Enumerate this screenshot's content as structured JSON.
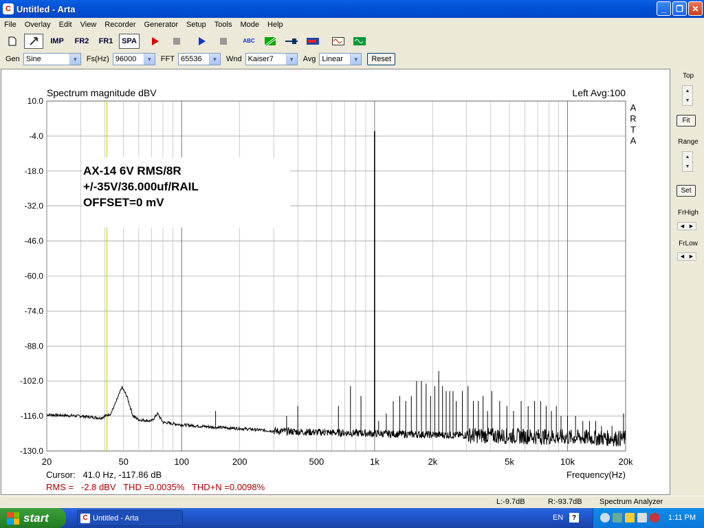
{
  "window": {
    "title": "Untitled - Arta",
    "icon_letter": "C"
  },
  "window_controls": {
    "minimize": "_",
    "maximize": "❐",
    "close": "✕"
  },
  "menu": [
    "File",
    "Overlay",
    "Edit",
    "View",
    "Recorder",
    "Generator",
    "Setup",
    "Tools",
    "Mode",
    "Help"
  ],
  "toolbar": {
    "imp": "IMP",
    "fr2": "FR2",
    "fr1": "FR1",
    "spa": "SPA",
    "abc": "ABC"
  },
  "controls": {
    "gen_label": "Gen",
    "gen_value": "Sine",
    "fs_label": "Fs(Hz)",
    "fs_value": "96000",
    "fft_label": "FFT",
    "fft_value": "65536",
    "wnd_label": "Wnd",
    "wnd_value": "Kaiser7",
    "avg_label": "Avg",
    "avg_value": "Linear",
    "reset_label": "Reset"
  },
  "right_panel": {
    "top": "Top",
    "fit": "Fit",
    "range": "Range",
    "set": "Set",
    "frhigh": "FrHigh",
    "frlow": "FrLow"
  },
  "plot": {
    "title": "Spectrum magnitude dBV",
    "channel_info": "Left  Avg:100",
    "brand": [
      "A",
      "R",
      "T",
      "A"
    ],
    "annotation": [
      "AX-14 6V RMS/8R",
      "+/-35V/36.000uf/RAIL",
      "OFFSET=0 mV"
    ],
    "cursor": "Cursor:   41.0 Hz, -117.86 dB",
    "measurements": "RMS =   -2.8 dBV   THD =0.0035%   THD+N =0.0098%",
    "xlabel": "Frequency(Hz)"
  },
  "chart_data": {
    "type": "line",
    "title": "Spectrum magnitude dBV",
    "xlabel": "Frequency(Hz)",
    "ylabel": "",
    "x_scale": "log",
    "xlim": [
      20,
      20000
    ],
    "ylim": [
      -130,
      10
    ],
    "x_ticks": [
      {
        "v": 20,
        "label": "20"
      },
      {
        "v": 50,
        "label": "50"
      },
      {
        "v": 100,
        "label": "100"
      },
      {
        "v": 200,
        "label": "200"
      },
      {
        "v": 500,
        "label": "500"
      },
      {
        "v": 1000,
        "label": "1k"
      },
      {
        "v": 2000,
        "label": "2k"
      },
      {
        "v": 5000,
        "label": "5k"
      },
      {
        "v": 10000,
        "label": "10k"
      },
      {
        "v": 20000,
        "label": "20k"
      }
    ],
    "y_ticks": [
      {
        "v": 10,
        "label": "10.0"
      },
      {
        "v": -4,
        "label": "-4.0"
      },
      {
        "v": -18,
        "label": "-18.0"
      },
      {
        "v": -32,
        "label": "-32.0"
      },
      {
        "v": -46,
        "label": "-46.0"
      },
      {
        "v": -60,
        "label": "-60.0"
      },
      {
        "v": -74,
        "label": "-74.0"
      },
      {
        "v": -88,
        "label": "-88.0"
      },
      {
        "v": -102,
        "label": "-102.0"
      },
      {
        "v": -116,
        "label": "-116.0"
      },
      {
        "v": -130,
        "label": "-130.0"
      }
    ],
    "grid": true,
    "cursor_x": 41,
    "noise_floor": [
      [
        20,
        -115.5
      ],
      [
        30,
        -116
      ],
      [
        38,
        -116.8
      ],
      [
        43,
        -115
      ],
      [
        46,
        -110
      ],
      [
        49,
        -104.5
      ],
      [
        52,
        -108
      ],
      [
        56,
        -116
      ],
      [
        60,
        -117.5
      ],
      [
        70,
        -118
      ],
      [
        75,
        -115
      ],
      [
        80,
        -118.5
      ],
      [
        100,
        -119.5
      ],
      [
        150,
        -120.5
      ],
      [
        200,
        -121
      ],
      [
        300,
        -122
      ],
      [
        500,
        -122.5
      ],
      [
        1000,
        -123
      ],
      [
        2000,
        -123.5
      ],
      [
        5000,
        -124
      ],
      [
        10000,
        -124.5
      ],
      [
        20000,
        -125
      ]
    ],
    "spurs": [
      [
        100,
        -120
      ],
      [
        150,
        -114
      ],
      [
        200,
        -121
      ],
      [
        250,
        -122
      ],
      [
        350,
        -116
      ],
      [
        400,
        -112
      ],
      [
        450,
        -122
      ],
      [
        550,
        -121
      ],
      [
        650,
        -112
      ],
      [
        750,
        -104
      ],
      [
        850,
        -108
      ],
      [
        1000,
        -2
      ],
      [
        1050,
        -118
      ],
      [
        1150,
        -115
      ],
      [
        1250,
        -110
      ],
      [
        1350,
        -108
      ],
      [
        1450,
        -110
      ],
      [
        1550,
        -108
      ],
      [
        1650,
        -102
      ],
      [
        1750,
        -102
      ],
      [
        1850,
        -103
      ],
      [
        1950,
        -108
      ],
      [
        2050,
        -104
      ],
      [
        2150,
        -98
      ],
      [
        2250,
        -104
      ],
      [
        2350,
        -106
      ],
      [
        2450,
        -106
      ],
      [
        2550,
        -106
      ],
      [
        2650,
        -110
      ],
      [
        2850,
        -106
      ],
      [
        3050,
        -104
      ],
      [
        3250,
        -110
      ],
      [
        3450,
        -110
      ],
      [
        3650,
        -108
      ],
      [
        3850,
        -114
      ],
      [
        4050,
        -106
      ],
      [
        4450,
        -110
      ],
      [
        4850,
        -112
      ],
      [
        5250,
        -114
      ],
      [
        5750,
        -110
      ],
      [
        6250,
        -112
      ],
      [
        6750,
        -110
      ],
      [
        7250,
        -110
      ],
      [
        7750,
        -112
      ],
      [
        8250,
        -114
      ],
      [
        8750,
        -112
      ],
      [
        9250,
        -116
      ],
      [
        10000,
        -116
      ],
      [
        11000,
        -116
      ],
      [
        12000,
        -118
      ],
      [
        13000,
        -118
      ],
      [
        14000,
        -118
      ],
      [
        15000,
        -120
      ],
      [
        17000,
        -120
      ],
      [
        19500,
        -115
      ]
    ]
  },
  "status": {
    "left": "L:-9.7dB",
    "right": "R:-93.7dB",
    "mode": "Spectrum Analyzer"
  },
  "taskbar": {
    "start": "start",
    "task": "Untitled - Arta",
    "lang": "EN",
    "help": "?",
    "clock": "1:11 PM"
  }
}
